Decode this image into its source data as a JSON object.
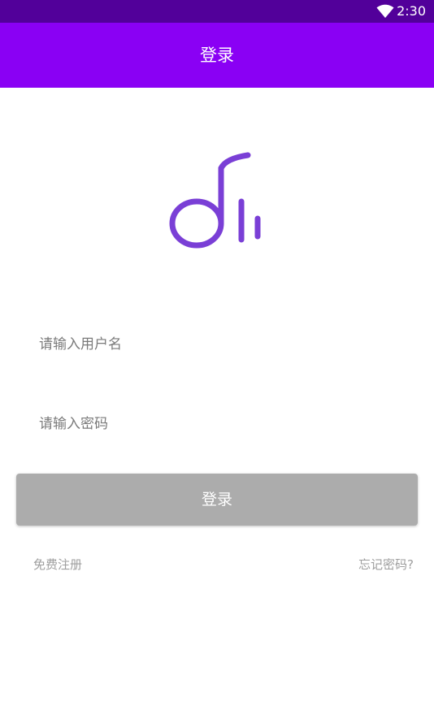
{
  "status_bar": {
    "time": "2:30",
    "wifi_icon": "wifi-icon"
  },
  "app_bar": {
    "title": "登录"
  },
  "logo": {
    "icon": "music-note-logo-icon",
    "color": "#7a3fd6"
  },
  "form": {
    "username_placeholder": "请输入用户名",
    "username_value": "",
    "password_placeholder": "请输入密码",
    "password_value": ""
  },
  "login_button": {
    "label": "登录"
  },
  "links": {
    "register": "免费注册",
    "forgot_password": "忘记密码?"
  },
  "colors": {
    "status_bar": "#52009a",
    "app_bar": "#8a00f4",
    "button_disabled": "#acacac"
  }
}
